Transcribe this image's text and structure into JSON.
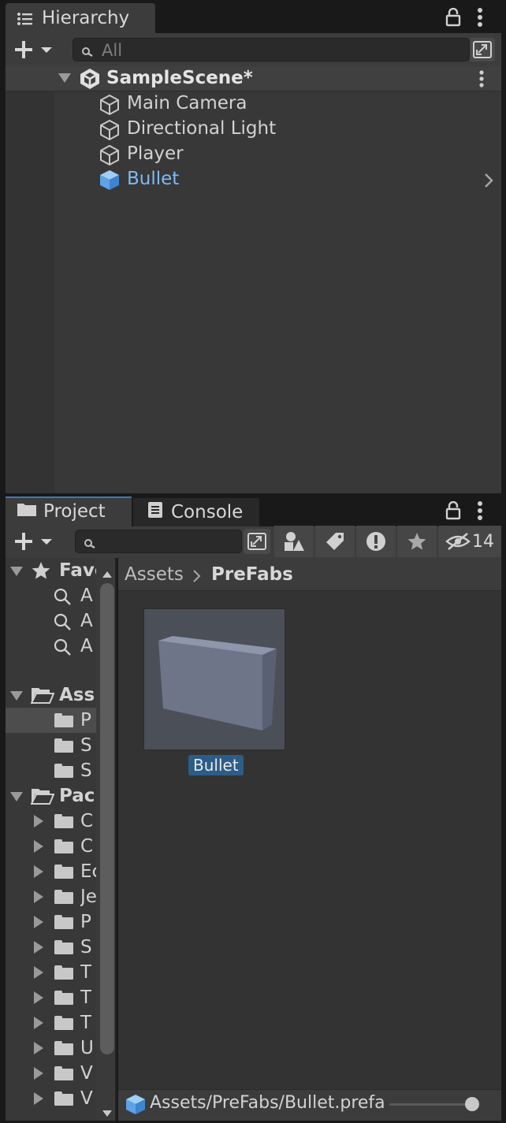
{
  "hierarchy": {
    "tab_label": "Hierarchy",
    "search_placeholder": "All",
    "scene_name": "SampleScene*",
    "items": [
      {
        "label": "Main Camera"
      },
      {
        "label": "Directional Light"
      },
      {
        "label": "Player"
      },
      {
        "label": "Bullet"
      }
    ]
  },
  "project": {
    "tabs": [
      {
        "label": "Project"
      },
      {
        "label": "Console"
      }
    ],
    "hidden_count": "14",
    "search_value": "",
    "breadcrumb": {
      "root": "Assets",
      "current": "PreFabs"
    },
    "favorites": {
      "label": "Favorites",
      "visible_text": "Favo",
      "items": [
        {
          "label": "All Materials",
          "visible_text": "A"
        },
        {
          "label": "All Models",
          "visible_text": "A"
        },
        {
          "label": "All Prefabs",
          "visible_text": "A"
        }
      ]
    },
    "assets_folder": {
      "label": "Assets",
      "visible_text": "Ass",
      "children": [
        {
          "visible_text": "P"
        },
        {
          "visible_text": "S"
        },
        {
          "visible_text": "S"
        }
      ]
    },
    "packages_folder": {
      "label": "Packages",
      "visible_text": "Pacl",
      "children": [
        {
          "visible_text": "C"
        },
        {
          "visible_text": "C"
        },
        {
          "visible_text": "Ec"
        },
        {
          "visible_text": "Je"
        },
        {
          "visible_text": "P"
        },
        {
          "visible_text": "S"
        },
        {
          "visible_text": "T"
        },
        {
          "visible_text": "T"
        },
        {
          "visible_text": "T"
        },
        {
          "visible_text": "U"
        },
        {
          "visible_text": "V"
        },
        {
          "visible_text": "V"
        }
      ]
    },
    "grid_items": [
      {
        "label": "Bullet"
      }
    ],
    "status_path": "Assets/PreFabs/Bullet.prefa",
    "zoom_level": 0.95
  },
  "colors": {
    "accent": "#3a79bb",
    "selection": "#2c5d87",
    "prefab_blue": "#5fa2e5",
    "prefab_text": "#7ebaf5"
  }
}
